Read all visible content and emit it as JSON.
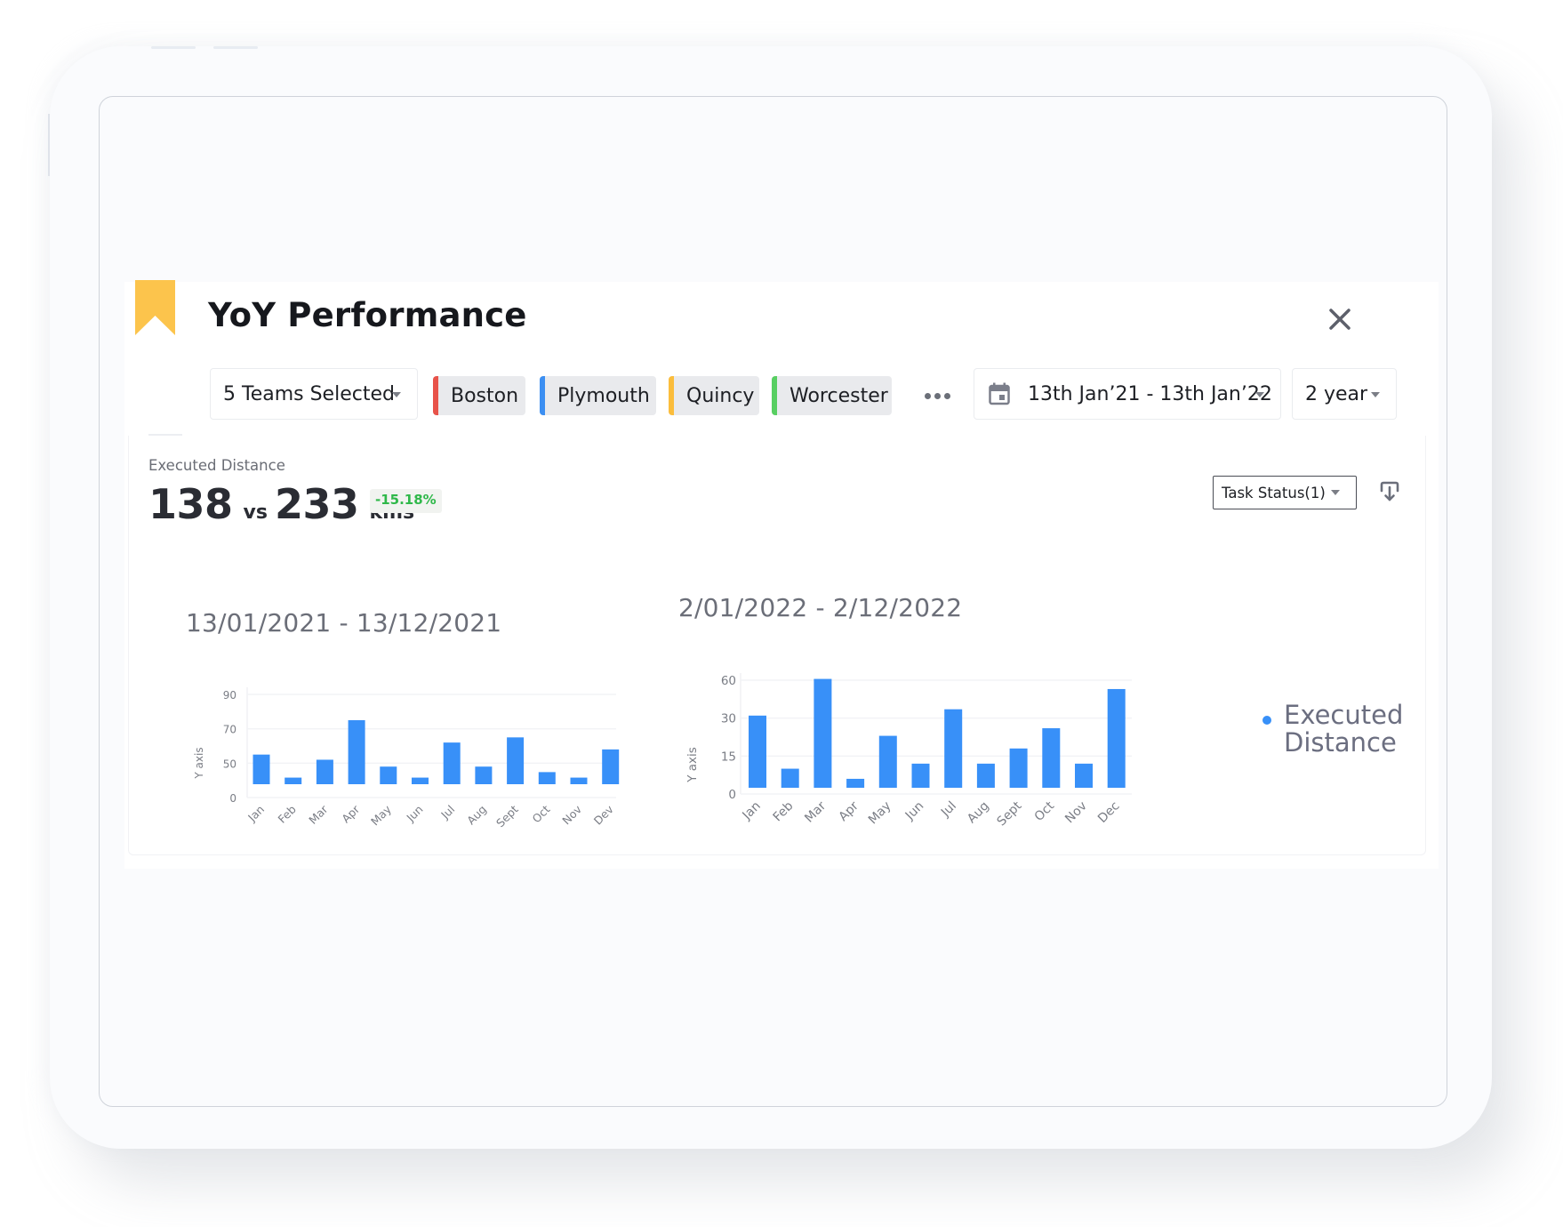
{
  "header": {
    "title": "YoY Performance",
    "close_icon": "close-icon",
    "bookmark_color": "#fcc44c"
  },
  "filters": {
    "teams_dropdown": "5 Teams Selected",
    "teams": [
      {
        "label": "Boston",
        "color": "#e8534a"
      },
      {
        "label": "Plymouth",
        "color": "#3c8ff2"
      },
      {
        "label": "Quincy",
        "color": "#fbbd3c"
      },
      {
        "label": "Worcester",
        "color": "#58cf62"
      }
    ],
    "more_icon": "more-horizontal-icon",
    "date_range": "13th Jan’21 - 13th Jan’22",
    "calendar_icon": "calendar-icon",
    "period": "2 year"
  },
  "metric": {
    "label": "Executed Distance",
    "current": "138",
    "vs_label": "vs",
    "previous": "233",
    "unit": "kms",
    "delta": "-15.18%",
    "delta_color": "#2fb84a"
  },
  "controls": {
    "task_status": "Task Status(1)",
    "download_icon": "download-icon"
  },
  "legend": {
    "label": "Executed Distance",
    "color": "#3890f8"
  },
  "chart_data": [
    {
      "type": "bar",
      "title": "13/01/2021 - 13/12/2021",
      "xlabel": "",
      "ylabel": "Y axis",
      "yticks": [
        0,
        50,
        70,
        90
      ],
      "ylim": [
        0,
        90
      ],
      "grid": true,
      "categories": [
        "Jan",
        "Feb",
        "Mar",
        "Apr",
        "May",
        "Jun",
        "Jul",
        "Aug",
        "Sept",
        "Oct",
        "Nov",
        "Dev"
      ],
      "series": [
        {
          "name": "Executed Distance",
          "color": "#3890f8",
          "values": [
            55,
            29,
            52,
            75,
            45,
            29,
            62,
            45,
            65,
            37,
            29,
            58
          ]
        }
      ]
    },
    {
      "type": "bar",
      "title": "2/01/2022 - 2/12/2022",
      "xlabel": "",
      "ylabel": "Y axis",
      "yticks": [
        0,
        15,
        30,
        60
      ],
      "ylim": [
        0,
        60
      ],
      "grid": true,
      "categories": [
        "Jan",
        "Feb",
        "Mar",
        "Apr",
        "May",
        "Jun",
        "Jul",
        "Aug",
        "Sept",
        "Oct",
        "Nov",
        "Dec"
      ],
      "series": [
        {
          "name": "Executed Distance",
          "color": "#3890f8",
          "values": [
            32,
            10,
            61,
            6,
            23,
            12,
            37,
            12,
            18,
            26,
            12,
            53
          ]
        }
      ],
      "legend": "right"
    }
  ]
}
